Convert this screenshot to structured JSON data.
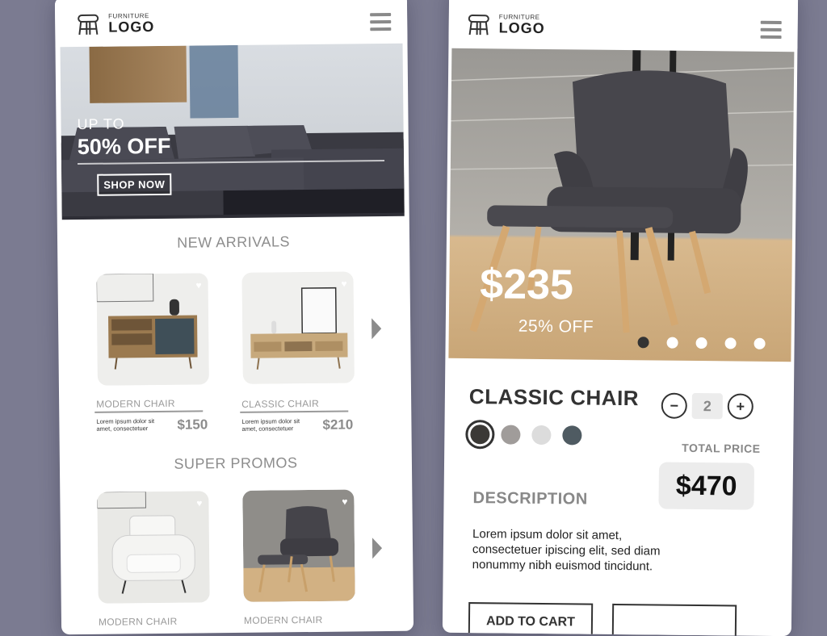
{
  "left_screen": {
    "logo_small": "FURNITURE",
    "logo_big": "LOGO",
    "hero": {
      "upto": "UP TO",
      "off": "50% OFF",
      "cta": "SHOP NOW"
    },
    "new_arrivals": {
      "title": "NEW ARRIVALS",
      "items": [
        {
          "name": "MODERN CHAIR",
          "desc": "Lorem ipsum dolor sit amet, consectetuer",
          "price": "$150"
        },
        {
          "name": "CLASSIC CHAIR",
          "desc": "Lorem ipsum dolor sit amet, consectetuer",
          "price": "$210"
        }
      ]
    },
    "super_promos": {
      "title": "SUPER PROMOS",
      "items": [
        {
          "name": "MODERN CHAIR"
        },
        {
          "name": "MODERN CHAIR"
        }
      ]
    }
  },
  "right_screen": {
    "logo_small": "FURNITURE",
    "logo_big": "LOGO",
    "hero": {
      "price": "$235",
      "off": "25% OFF",
      "carousel_active": 1,
      "carousel_count": 5
    },
    "product": {
      "title": "CLASSIC CHAIR",
      "quantity": "2",
      "minus": "−",
      "plus": "+",
      "colors": [
        "#3b3936",
        "#a09c9a",
        "#dcdcdc",
        "#4f5b62"
      ],
      "selected_color": 0,
      "total_label": "TOTAL PRICE",
      "total": "$470",
      "description_title": "DESCRIPTION",
      "description": "Lorem ipsum dolor sit amet, consectetuer ipiscing elit, sed diam nonummy nibh euismod tincidunt.",
      "add_to_cart": "ADD TO CART"
    }
  }
}
